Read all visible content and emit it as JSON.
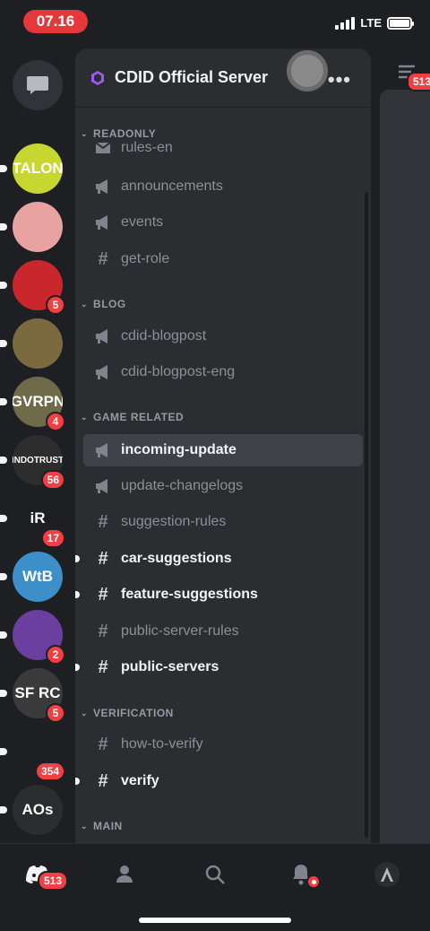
{
  "status": {
    "time": "07.16",
    "network": "LTE"
  },
  "server": {
    "name": "CDID Official Server"
  },
  "rail": {
    "servers": [
      {
        "name": "TALON",
        "badge": "",
        "unread": true,
        "color": "#c8d632"
      },
      {
        "name": "",
        "badge": "",
        "unread": true,
        "color": "#e8a3a0"
      },
      {
        "name": "",
        "badge": "5",
        "unread": true,
        "color": "#c9272c"
      },
      {
        "name": "",
        "badge": "",
        "unread": true,
        "color": "#7a6a3e"
      },
      {
        "name": "GVRPN",
        "badge": "4",
        "unread": true,
        "color": "#6f6a4a"
      },
      {
        "name": "INDOTRUST",
        "badge": "56",
        "unread": true,
        "color": "#2d2d2d"
      },
      {
        "name": "iR",
        "badge": "17",
        "unread": true,
        "color": "#1e1f22"
      },
      {
        "name": "WtB",
        "badge": "",
        "unread": true,
        "color": "#3c8fc9"
      },
      {
        "name": "",
        "badge": "2",
        "unread": true,
        "color": "#6a3fa0"
      },
      {
        "name": "SF RC",
        "badge": "5",
        "unread": true,
        "color": "#3a3a3a"
      },
      {
        "name": "",
        "badge": "354",
        "unread": true,
        "color": "#1e1f22"
      },
      {
        "name": "AOs",
        "badge": "",
        "unread": true,
        "color": "#2b2d31"
      }
    ]
  },
  "categories": {
    "readonly": "READONLY",
    "blog": "BLOG",
    "game": "GAME RELATED",
    "verification": "VERIFICATION",
    "main": "MAIN"
  },
  "channels": {
    "rules_en": "rules-en",
    "announcements": "announcements",
    "events": "events",
    "get_role": "get-role",
    "blogpost": "cdid-blogpost",
    "blogpost_eng": "cdid-blogpost-eng",
    "incoming_update": "incoming-update",
    "update_changelogs": "update-changelogs",
    "suggestion_rules": "suggestion-rules",
    "car_suggestions": "car-suggestions",
    "feature_suggestions": "feature-suggestions",
    "public_server_rules": "public-server-rules",
    "public_servers": "public-servers",
    "how_to_verify": "how-to-verify",
    "verify": "verify"
  },
  "sliver": {
    "badge": "513"
  },
  "nav": {
    "home_badge": "513"
  }
}
